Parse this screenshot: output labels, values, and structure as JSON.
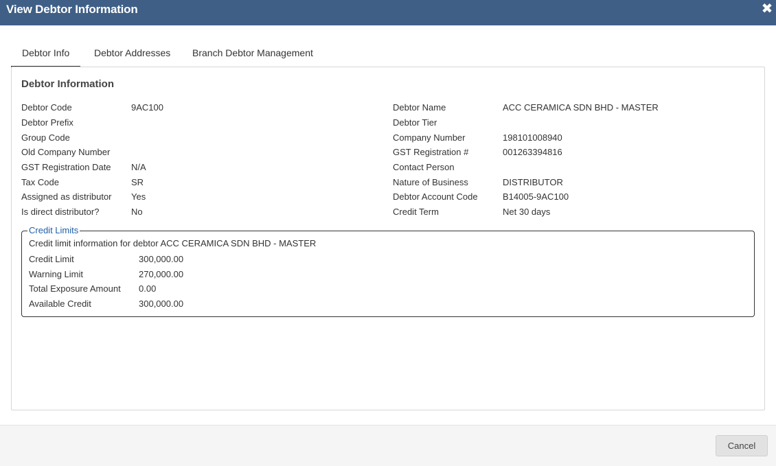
{
  "window": {
    "title": "View Debtor Information",
    "close_icon": "close-icon"
  },
  "tabs": [
    {
      "label": "Debtor Info",
      "active": true
    },
    {
      "label": "Debtor Addresses",
      "active": false
    },
    {
      "label": "Branch Debtor Management",
      "active": false
    }
  ],
  "section": {
    "title": "Debtor Information"
  },
  "left_fields": [
    {
      "label": "Debtor Code",
      "value": "9AC100"
    },
    {
      "label": "Debtor Prefix",
      "value": ""
    },
    {
      "label": "Group Code",
      "value": ""
    },
    {
      "label": "Old Company Number",
      "value": ""
    },
    {
      "label": "GST Registration Date",
      "value": "N/A"
    },
    {
      "label": "Tax Code",
      "value": "SR"
    },
    {
      "label": "Assigned as distributor",
      "value": "Yes"
    },
    {
      "label": "Is direct distributor?",
      "value": "No"
    }
  ],
  "right_fields": [
    {
      "label": "Debtor Name",
      "value": "ACC CERAMICA SDN BHD - MASTER"
    },
    {
      "label": "Debtor Tier",
      "value": ""
    },
    {
      "label": "Company Number",
      "value": "198101008940"
    },
    {
      "label": "GST Registration #",
      "value": "001263394816"
    },
    {
      "label": "Contact Person",
      "value": ""
    },
    {
      "label": "Nature of Business",
      "value": "DISTRIBUTOR"
    },
    {
      "label": "Debtor Account Code",
      "value": "B14005-9AC100"
    },
    {
      "label": "Credit Term",
      "value": "Net 30 days"
    }
  ],
  "credit_limits": {
    "legend": "Credit Limits",
    "description": "Credit limit information for debtor ACC CERAMICA SDN BHD - MASTER",
    "fields": [
      {
        "label": "Credit Limit",
        "value": "300,000.00"
      },
      {
        "label": "Warning Limit",
        "value": "270,000.00"
      },
      {
        "label": "Total Exposure Amount",
        "value": "0.00"
      },
      {
        "label": "Available Credit",
        "value": "300,000.00"
      }
    ]
  },
  "footer": {
    "cancel_label": "Cancel"
  },
  "colors": {
    "titlebar": "#3f5f86",
    "legend": "#1f5fa8",
    "footer": "#f5f5f6"
  }
}
